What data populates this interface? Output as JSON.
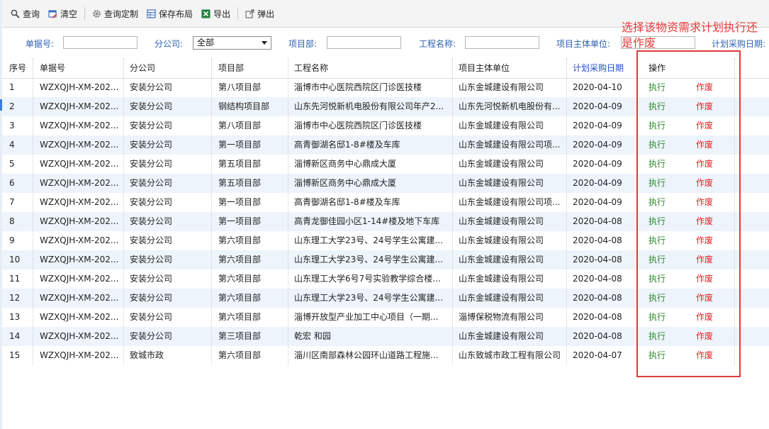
{
  "toolbar": {
    "query": "查询",
    "clear": "清空",
    "custom_query": "查询定制",
    "save_layout": "保存布局",
    "export": "导出",
    "popup": "弹出"
  },
  "filters": {
    "doc_no_label": "单据号:",
    "branch_label": "分公司:",
    "branch_value": "全部",
    "dept_label": "项目部:",
    "project_label": "工程名称:",
    "owner_label": "项目主体单位:",
    "plan_date_label": "计划采购日期:"
  },
  "annotation": {
    "text": "选择该物资需求计划执行还是作废"
  },
  "columns": {
    "seq": "序号",
    "doc_no": "单据号",
    "branch": "分公司",
    "dept": "项目部",
    "project": "工程名称",
    "owner": "项目主体单位",
    "plan_date": "计划采购日期",
    "ops": "操作"
  },
  "rows": [
    {
      "seq": "1",
      "doc": "WZXQJH-XM-202...",
      "branch": "安装分公司",
      "dept": "第八项目部",
      "project": "淄博市中心医院西院区门诊医技楼",
      "owner": "山东金城建设有限公司",
      "date": "2020-04-10",
      "exec": "执行",
      "void": "作废"
    },
    {
      "seq": "2",
      "doc": "WZXQJH-XM-202...",
      "branch": "安装分公司",
      "dept": "钢结构项目部",
      "project": "山东先河悦新机电股份有限公司年产2...",
      "owner": "山东先河悦新机电股份有...",
      "date": "2020-04-09",
      "exec": "执行",
      "void": "作废"
    },
    {
      "seq": "3",
      "doc": "WZXQJH-XM-202...",
      "branch": "安装分公司",
      "dept": "第八项目部",
      "project": "淄博市中心医院西院区门诊医技楼",
      "owner": "山东金城建设有限公司",
      "date": "2020-04-09",
      "exec": "执行",
      "void": "作废"
    },
    {
      "seq": "4",
      "doc": "WZXQJH-XM-202...",
      "branch": "安装分公司",
      "dept": "第一项目部",
      "project": "高青御湖名邸1-8#楼及车库",
      "owner": "山东金城建设有限公司项...",
      "date": "2020-04-09",
      "exec": "执行",
      "void": "作废"
    },
    {
      "seq": "5",
      "doc": "WZXQJH-XM-202...",
      "branch": "安装分公司",
      "dept": "第五项目部",
      "project": "淄博新区商务中心鼎成大厦",
      "owner": "山东金城建设有限公司",
      "date": "2020-04-09",
      "exec": "执行",
      "void": "作废"
    },
    {
      "seq": "6",
      "doc": "WZXQJH-XM-202...",
      "branch": "安装分公司",
      "dept": "第五项目部",
      "project": "淄博新区商务中心鼎成大厦",
      "owner": "山东金城建设有限公司",
      "date": "2020-04-09",
      "exec": "执行",
      "void": "作废"
    },
    {
      "seq": "7",
      "doc": "WZXQJH-XM-202...",
      "branch": "安装分公司",
      "dept": "第一项目部",
      "project": "高青御湖名邸1-8#楼及车库",
      "owner": "山东金城建设有限公司项...",
      "date": "2020-04-09",
      "exec": "执行",
      "void": "作废"
    },
    {
      "seq": "8",
      "doc": "WZXQJH-XM-202...",
      "branch": "安装分公司",
      "dept": "第一项目部",
      "project": "高青龙御佳园小区1-14#楼及地下车库",
      "owner": "山东金城建设有限公司",
      "date": "2020-04-08",
      "exec": "执行",
      "void": "作废"
    },
    {
      "seq": "9",
      "doc": "WZXQJH-XM-202...",
      "branch": "安装分公司",
      "dept": "第六项目部",
      "project": "山东理工大学23号、24号学生公寓建...",
      "owner": "山东金城建设有限公司",
      "date": "2020-04-08",
      "exec": "执行",
      "void": "作废"
    },
    {
      "seq": "10",
      "doc": "WZXQJH-XM-202...",
      "branch": "安装分公司",
      "dept": "第六项目部",
      "project": "山东理工大学23号、24号学生公寓建...",
      "owner": "山东金城建设有限公司",
      "date": "2020-04-08",
      "exec": "执行",
      "void": "作废"
    },
    {
      "seq": "11",
      "doc": "WZXQJH-XM-202...",
      "branch": "安装分公司",
      "dept": "第六项目部",
      "project": "山东理工大学6号7号实验教学综合楼...",
      "owner": "山东金城建设有限公司",
      "date": "2020-04-08",
      "exec": "执行",
      "void": "作废"
    },
    {
      "seq": "12",
      "doc": "WZXQJH-XM-202...",
      "branch": "安装分公司",
      "dept": "第六项目部",
      "project": "山东理工大学23号、24号学生公寓建...",
      "owner": "山东金城建设有限公司",
      "date": "2020-04-08",
      "exec": "执行",
      "void": "作废"
    },
    {
      "seq": "13",
      "doc": "WZXQJH-XM-202...",
      "branch": "安装分公司",
      "dept": "第六项目部",
      "project": "淄博开放型产业加工中心项目（一期...",
      "owner": "淄博保税物流有限公司",
      "date": "2020-04-08",
      "exec": "执行",
      "void": "作废"
    },
    {
      "seq": "14",
      "doc": "WZXQJH-XM-202...",
      "branch": "安装分公司",
      "dept": "第三项目部",
      "project": "乾宏 和园",
      "owner": "山东金城建设有限公司",
      "date": "2020-04-08",
      "exec": "执行",
      "void": "作废"
    },
    {
      "seq": "15",
      "doc": "WZXQJH-XM-202...",
      "branch": "致城市政",
      "dept": "第六项目部",
      "project": "淄川区南部森林公园环山道路工程施...",
      "owner": "山东致城市政工程有限公司",
      "date": "2020-04-07",
      "exec": "执行",
      "void": "作废"
    }
  ],
  "colors": {
    "label_blue": "#2c5fb0",
    "exec_green": "#2b8a2b",
    "void_red": "#e02020",
    "row_alt": "#edf4fb",
    "annotation_red": "#e03a3a"
  }
}
